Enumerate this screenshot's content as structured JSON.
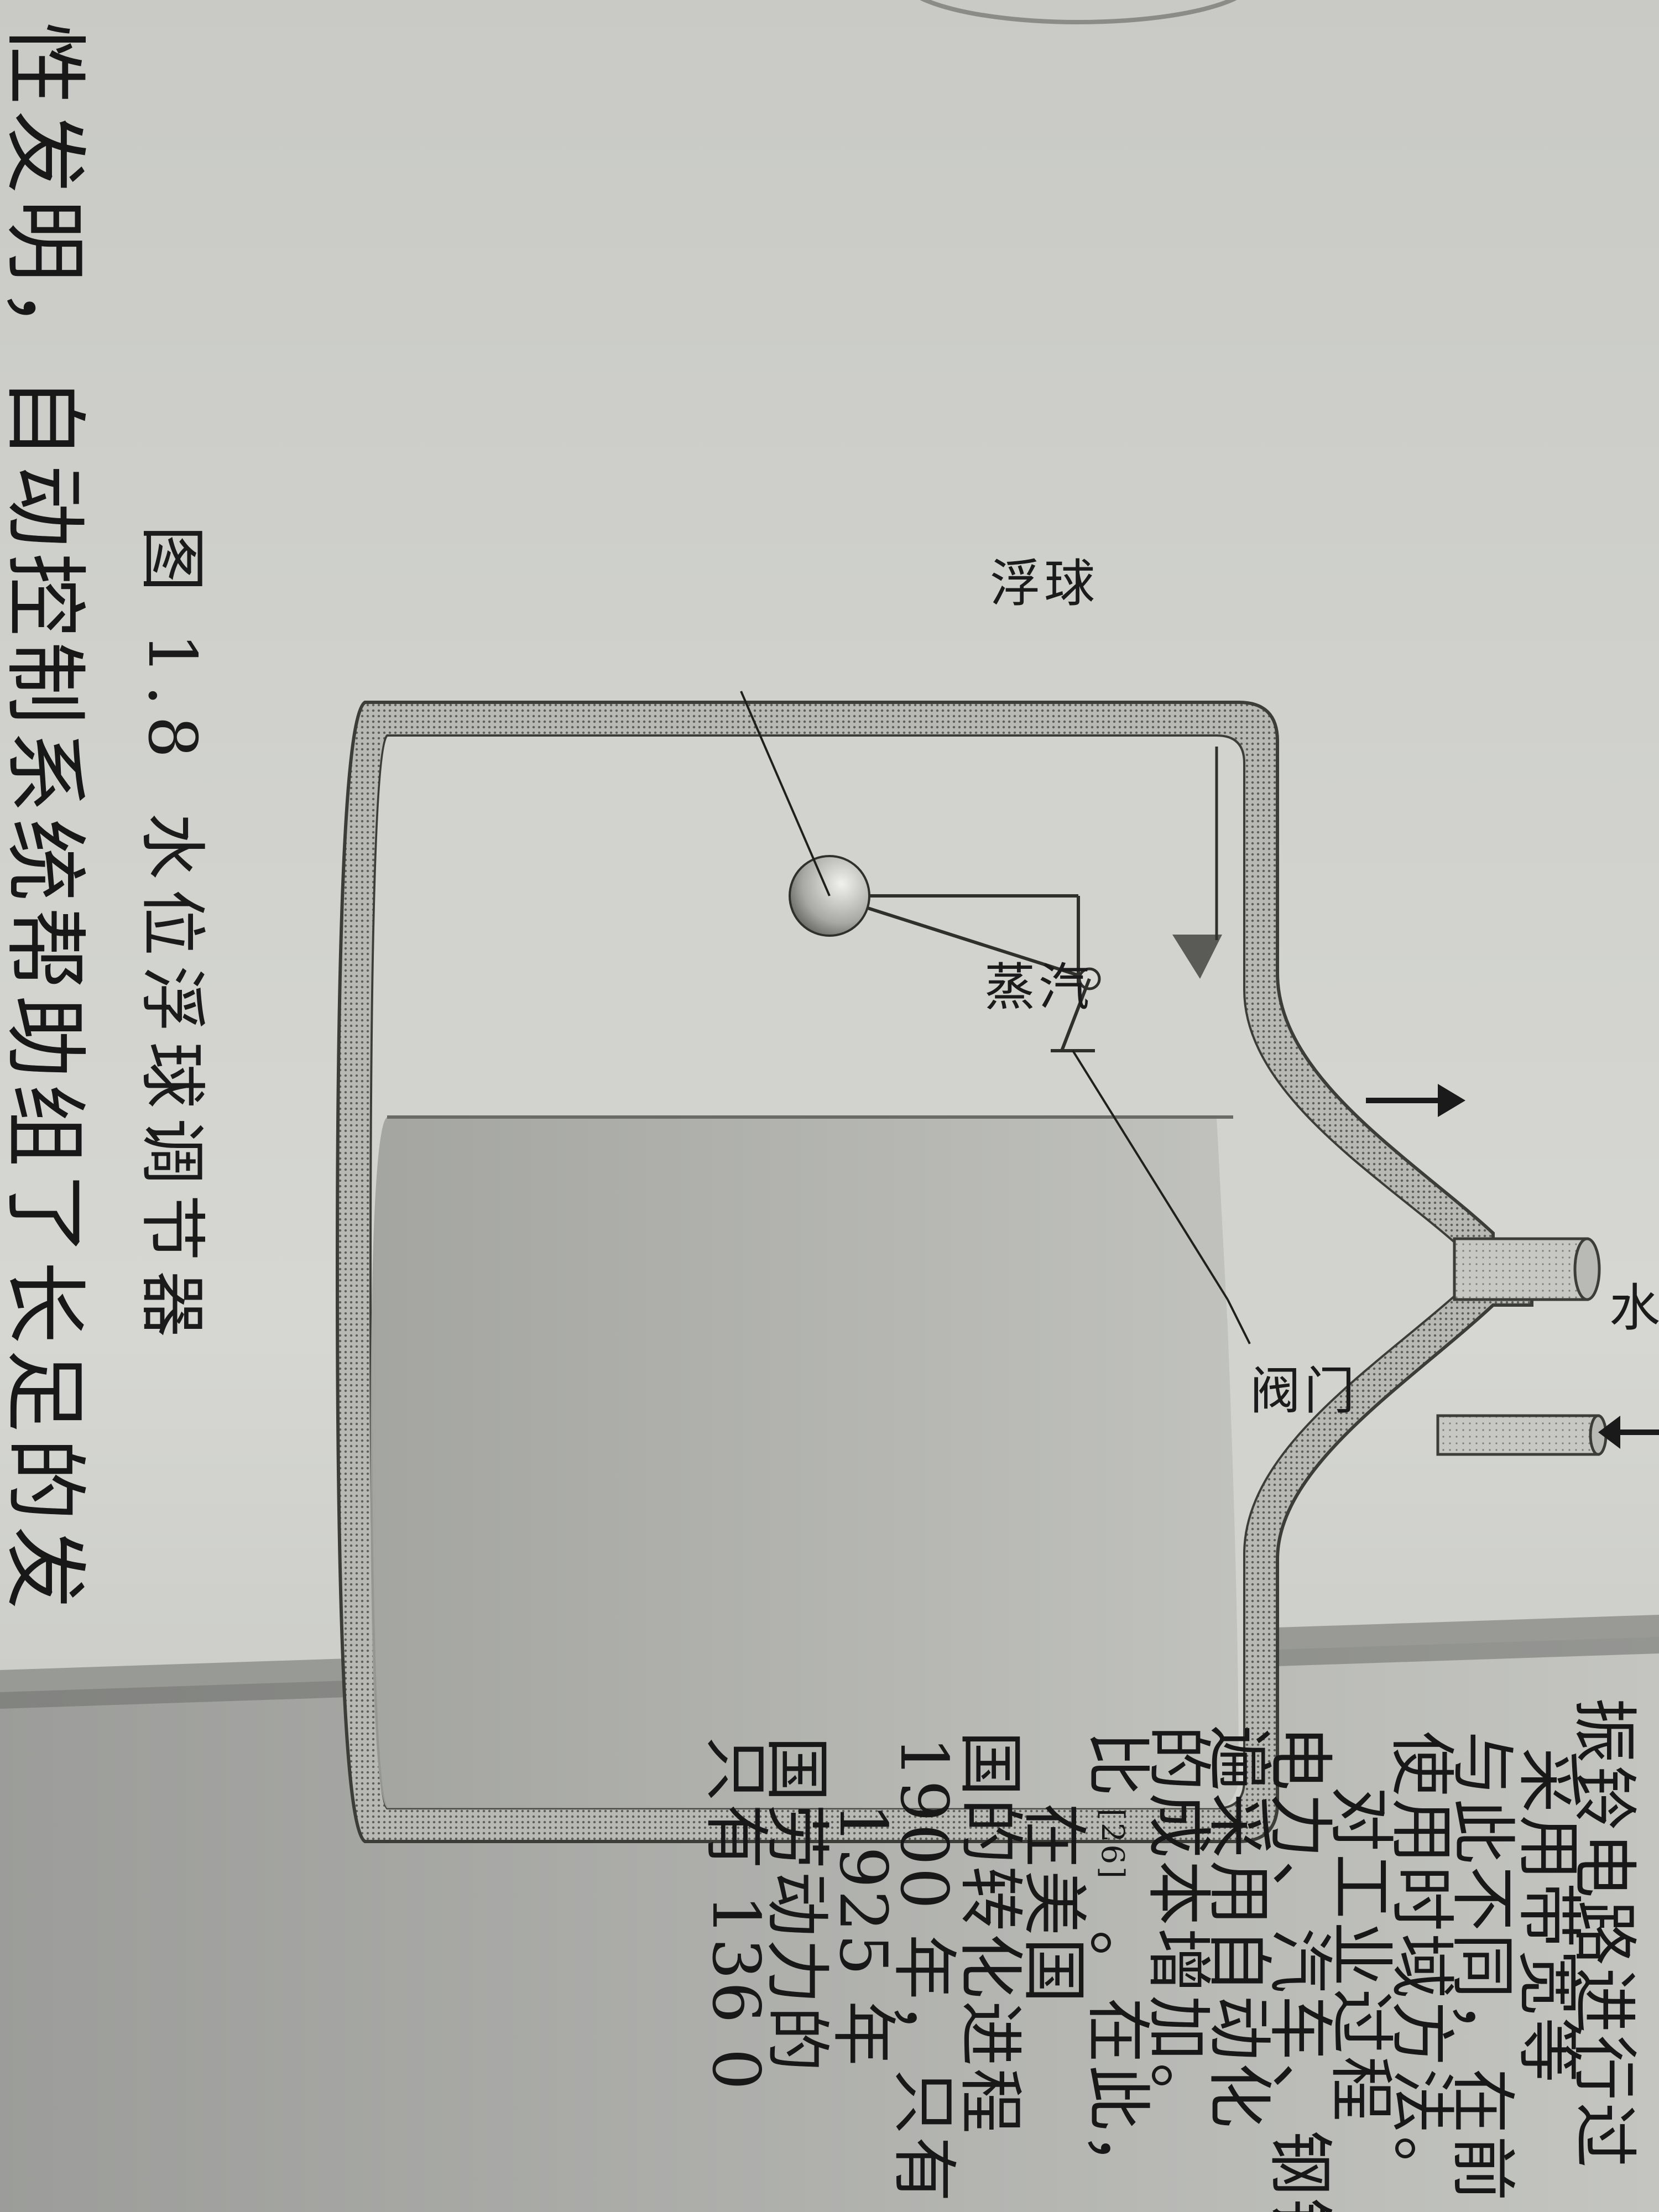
{
  "figure": {
    "caption_number": "图 1.8",
    "caption_title": "水位浮球调节器",
    "labels": {
      "float": "浮球",
      "steam": "蒸汽",
      "water": "水",
      "valve": "阀门"
    }
  },
  "left_page": {
    "lines": [
      "性发明，自动控制系统帮助组了长足的发"
    ]
  },
  "right_page": {
    "lines": [
      "振铃电路进行过",
      "采用带宽等",
      "与此不同，在前",
      "使用时域方法。",
      "对工业过程",
      "电力、汽车、钢铁",
      "遍采用自动化",
      "的成本增加。",
      "比",
      "。在此，",
      "在美国",
      "国的转化进程",
      "1900 年，只有",
      "1925 年",
      "国劳动力的",
      "只有 136 0"
    ],
    "citation": "[26]"
  }
}
